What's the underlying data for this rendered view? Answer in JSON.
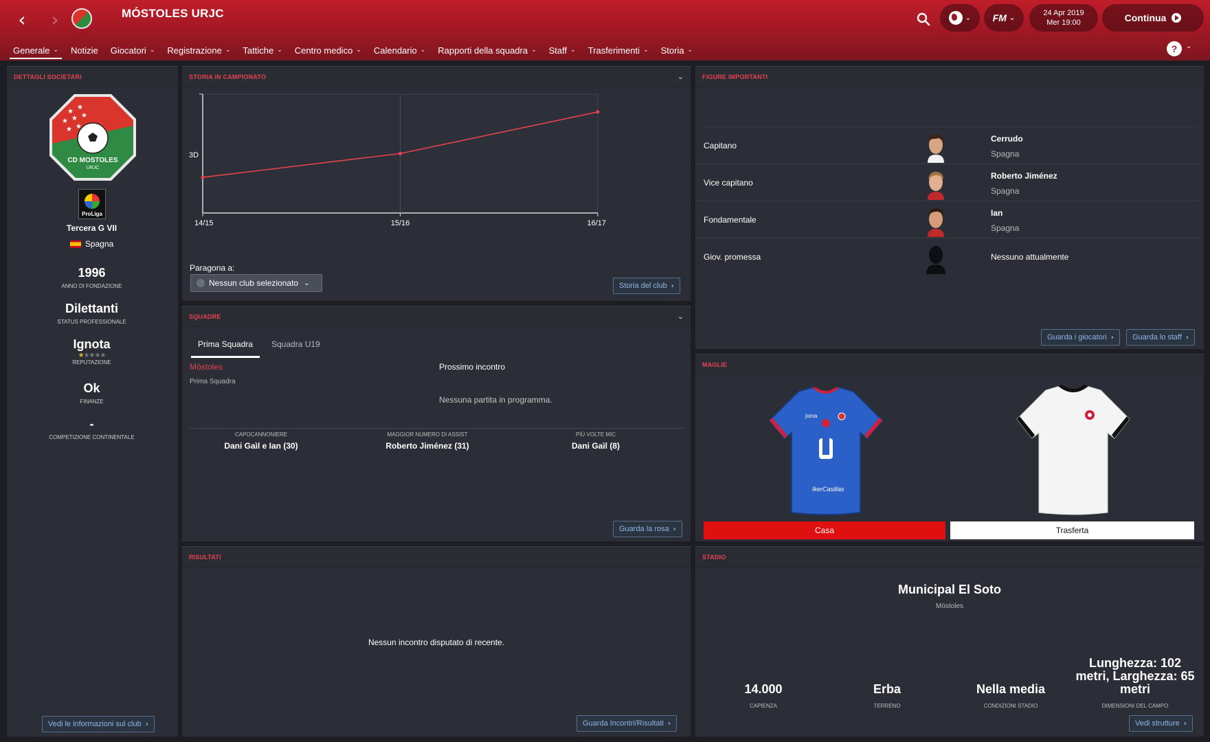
{
  "header": {
    "club_name": "MÓSTOLES URJC",
    "date": "24 Apr 2019",
    "time": "Mer 19:00",
    "continue_label": "Continua",
    "fm_label": "FM"
  },
  "menu": [
    {
      "label": "Generale",
      "dropdown": true,
      "active": true
    },
    {
      "label": "Notizie",
      "dropdown": false
    },
    {
      "label": "Giocatori",
      "dropdown": true
    },
    {
      "label": "Registrazione",
      "dropdown": true
    },
    {
      "label": "Tattiche",
      "dropdown": true
    },
    {
      "label": "Centro medico",
      "dropdown": true
    },
    {
      "label": "Calendario",
      "dropdown": true
    },
    {
      "label": "Rapporti della squadra",
      "dropdown": true
    },
    {
      "label": "Staff",
      "dropdown": true
    },
    {
      "label": "Trasferimenti",
      "dropdown": true
    },
    {
      "label": "Storia",
      "dropdown": true
    }
  ],
  "club_details": {
    "title": "DETTAGLI SOCIETARI",
    "crest_text": "CD MOSTOLES",
    "crest_sub": "URJC",
    "league_logo_text": "ProLiga",
    "division": "Tercera G VII",
    "nation": "Spagna",
    "founded": "1996",
    "founded_label": "ANNO DI FONDAZIONE",
    "status": "Dilettanti",
    "status_label": "STATUS PROFESSIONALE",
    "reputation": "Ignota",
    "reputation_stars": 0.5,
    "reputation_label": "REPUTAZIONE",
    "finances": "Ok",
    "finances_label": "FINANZE",
    "continental": "-",
    "continental_label": "COMPETIZIONE CONTINENTALE",
    "info_button": "Vedi le informazioni sul club"
  },
  "league_history": {
    "title": "STORIA IN CAMPIONATO",
    "compare_label": "Paragona a:",
    "compare_value": "Nessun club selezionato",
    "history_button": "Storia del club"
  },
  "chart_data": {
    "type": "line",
    "categories": [
      "14/15",
      "15/16",
      "16/17"
    ],
    "y_tick_label": "3D",
    "values": [
      0.3,
      0.5,
      0.85
    ]
  },
  "squads": {
    "title": "SQUADRE",
    "tabs": [
      "Prima Squadra",
      "Squadra U19"
    ],
    "team_name": "Móstoles",
    "team_type": "Prima Squadra",
    "next_match_label": "Prossimo incontro",
    "next_match_value": "Nessuna partita in programma.",
    "stats": [
      {
        "label": "CAPOCANNONIERE",
        "value": "Dani Gaìl e Ian (30)"
      },
      {
        "label": "MAGGIOR NUMERO DI ASSIST",
        "value": "Roberto Jiménez (31)"
      },
      {
        "label": "PIÙ VOLTE MIC",
        "value": "Dani Gaìl (8)"
      }
    ],
    "squad_button": "Guarda la rosa"
  },
  "results": {
    "title": "RISULTATI",
    "empty": "Nessun incontro disputato di recente.",
    "button": "Guarda Incontri/Risultati"
  },
  "key_figures": {
    "title": "FIGURE IMPORTANTI",
    "rows": [
      {
        "role": "Capitano",
        "name": "Cerrudo",
        "nation": "Spagna"
      },
      {
        "role": "Vice capitano",
        "name": "Roberto Jiménez",
        "nation": "Spagna"
      },
      {
        "role": "Fondamentale",
        "name": "Ian",
        "nation": "Spagna"
      },
      {
        "role": "Giov. promessa",
        "name": "",
        "nation": "",
        "none": "Nessuno attualmente"
      }
    ],
    "players_button": "Guarda i giocatori",
    "staff_button": "Guarda lo staff"
  },
  "kits": {
    "title": "MAGLIE",
    "home_label": "Casa",
    "away_label": "Trasferta",
    "home_color": "#e01010",
    "away_color": "#ffffff"
  },
  "stadium": {
    "title": "STADIO",
    "name": "Municipal El Soto",
    "city": "Móstoles",
    "stats": [
      {
        "value": "14.000",
        "label": "CAPIENZA"
      },
      {
        "value": "Erba",
        "label": "TERRENO"
      },
      {
        "value": "Nella media",
        "label": "CONDIZIONI STADIO"
      },
      {
        "value": "Lunghezza: 102 metri, Larghezza: 65 metri",
        "label": "DIMENSIONI DEL CAMPO"
      }
    ],
    "button": "Vedi strutture"
  }
}
